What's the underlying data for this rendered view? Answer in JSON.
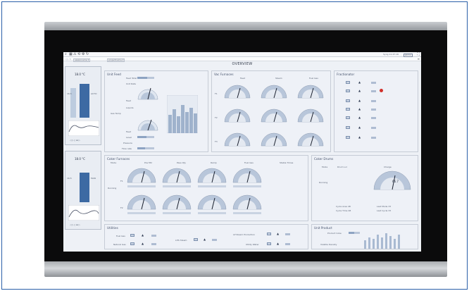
{
  "toolbar": {
    "tab1": "sessioname  ▾",
    "tab2": "projectname  ▾",
    "status": "Syng 11:47:16",
    "user": "admin"
  },
  "screen_title": "OVERVIEW",
  "left": {
    "top_card": {
      "l1": "18.0 °C",
      "l2": "16.5",
      "l3": "AUTO"
    },
    "bottom_card": {
      "l1": "18.0 °C",
      "l2": "16.5",
      "l3": "MAN"
    },
    "icons": "◁  ▷ ▯ ⊞ ▷"
  },
  "unit_feed": {
    "title": "Unit Feed",
    "labels": [
      "Feed Total",
      "Unit Rate",
      "Feed",
      "Liquids",
      "Gas Temp",
      "Feed",
      "Level",
      "Pressure",
      "Flow rate"
    ]
  },
  "vac_furnaces": {
    "title": "Vac Furnaces",
    "cols": [
      "Feed",
      "Steam",
      "Fuel Gas"
    ],
    "rows": [
      "F1",
      "F2",
      "F3"
    ]
  },
  "fractionator": {
    "title": "Fractionator"
  },
  "coker_furnaces": {
    "title": "Coker Furnaces",
    "cols": [
      "Mode",
      "Pos Mtr",
      "Pass Qty",
      "Ramp",
      "Fuel Gas",
      "Stable Times"
    ],
    "rows": [
      "F1",
      "F2"
    ],
    "extra": "Running"
  },
  "coker_drums": {
    "title": "Coker Drums",
    "cols": [
      "Mode",
      "Drum Lvl",
      "Charge"
    ],
    "extra": "Running",
    "val": "66.7",
    "stats": [
      "Cycle Area 48",
      "Cycle Time 48",
      "Last Mode 33",
      "Last Cycle 33"
    ]
  },
  "utilities": {
    "title": "Utilities",
    "items": [
      "Fuel Gas",
      "Natural Gas",
      "LHS Steam",
      "LP Steam Production",
      "Utility Water"
    ]
  },
  "unit_product": {
    "title": "Unit Product",
    "items": [
      "Product Coke",
      "Volatile Density"
    ]
  },
  "colors": {
    "accent": "#2a5fa8",
    "panel": "#eef1f7",
    "gauge_fill": "#b8c6da",
    "gauge_dark": "#6c84a8"
  }
}
